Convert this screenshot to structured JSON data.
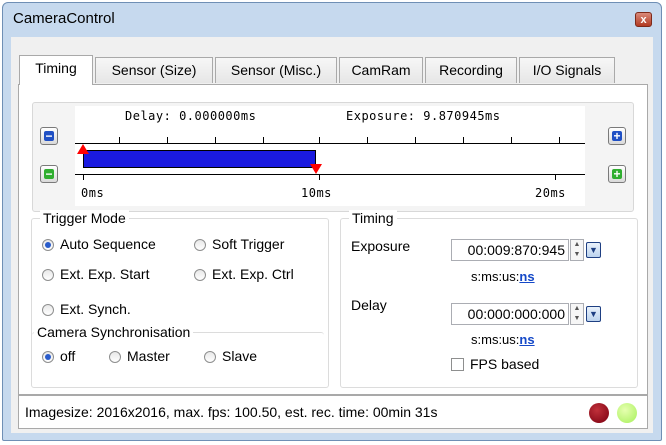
{
  "window": {
    "title": "CameraControl",
    "close_glyph": "x"
  },
  "tabs": [
    {
      "label": "Timing",
      "active": true
    },
    {
      "label": "Sensor (Size)",
      "active": false
    },
    {
      "label": "Sensor (Misc.)",
      "active": false
    },
    {
      "label": "CamRam",
      "active": false
    },
    {
      "label": "Recording",
      "active": false
    },
    {
      "label": "I/O Signals",
      "active": false
    }
  ],
  "timeline": {
    "delay_text": "Delay: 0.000000ms",
    "exposure_text": "Exposure: 9.870945ms",
    "tick_labels": [
      "0ms",
      "10ms",
      "20ms"
    ],
    "range_ms": [
      0,
      20
    ],
    "exposure_ms": 9.870945,
    "delay_ms": 0.0,
    "bar_color": "#1a1ae0",
    "marker_color": "#ff0000",
    "buttons": {
      "zoom_out_blue": "minus-icon",
      "zoom_out_green": "minus-icon",
      "zoom_in_blue": "plus-icon",
      "zoom_in_green": "plus-icon"
    }
  },
  "trigger_mode": {
    "title": "Trigger Mode",
    "options": [
      {
        "label": "Auto Sequence",
        "selected": true
      },
      {
        "label": "Soft Trigger",
        "selected": false
      },
      {
        "label": "Ext. Exp. Start",
        "selected": false
      },
      {
        "label": "Ext. Exp. Ctrl",
        "selected": false
      },
      {
        "label": "Ext. Synch.",
        "selected": false
      }
    ]
  },
  "camera_sync": {
    "title": "Camera Synchronisation",
    "options": [
      {
        "label": "off",
        "selected": true
      },
      {
        "label": "Master",
        "selected": false
      },
      {
        "label": "Slave",
        "selected": false
      }
    ]
  },
  "timing": {
    "title": "Timing",
    "exposure": {
      "label": "Exposure",
      "value": "00:009:870:945",
      "units_prefix": "s:ms:us:",
      "units_link": "ns"
    },
    "delay": {
      "label": "Delay",
      "value": "00:000:000:000",
      "units_prefix": "s:ms:us:",
      "units_link": "ns"
    },
    "fps_based": {
      "label": "FPS based",
      "checked": false
    }
  },
  "status": {
    "text": "Imagesize: 2016x2016, max. fps: 100.50, est. rec. time: 00min 31s",
    "led_red": "#7a0010",
    "led_green": "#a6f05a"
  }
}
